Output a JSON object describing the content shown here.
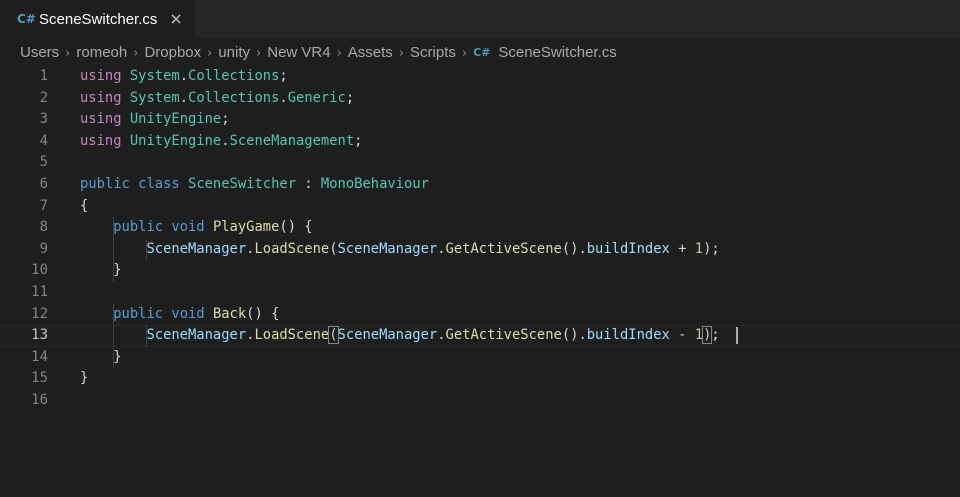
{
  "tab": {
    "icon": "C#",
    "title": "SceneSwitcher.cs",
    "close": "×"
  },
  "breadcrumb": {
    "segments": [
      "Users",
      "romeoh",
      "Dropbox",
      "unity",
      "New VR4",
      "Assets",
      "Scripts"
    ],
    "file_icon": "C#",
    "file": "SceneSwitcher.cs",
    "separator": "›"
  },
  "editor": {
    "current_line": 13,
    "lines": [
      {
        "n": "1",
        "tokens": [
          [
            "kwu",
            "using"
          ],
          [
            "pl",
            " "
          ],
          [
            "ty",
            "System"
          ],
          [
            "pl",
            "."
          ],
          [
            "ty",
            "Collections"
          ],
          [
            "pl",
            ";"
          ]
        ]
      },
      {
        "n": "2",
        "tokens": [
          [
            "kwu",
            "using"
          ],
          [
            "pl",
            " "
          ],
          [
            "ty",
            "System"
          ],
          [
            "pl",
            "."
          ],
          [
            "ty",
            "Collections"
          ],
          [
            "pl",
            "."
          ],
          [
            "ty",
            "Generic"
          ],
          [
            "pl",
            ";"
          ]
        ]
      },
      {
        "n": "3",
        "tokens": [
          [
            "kwu",
            "using"
          ],
          [
            "pl",
            " "
          ],
          [
            "ty",
            "UnityEngine"
          ],
          [
            "pl",
            ";"
          ]
        ]
      },
      {
        "n": "4",
        "tokens": [
          [
            "kwu",
            "using"
          ],
          [
            "pl",
            " "
          ],
          [
            "ty",
            "UnityEngine"
          ],
          [
            "pl",
            "."
          ],
          [
            "ty",
            "SceneManagement"
          ],
          [
            "pl",
            ";"
          ]
        ]
      },
      {
        "n": "5",
        "tokens": []
      },
      {
        "n": "6",
        "tokens": [
          [
            "kw",
            "public"
          ],
          [
            "pl",
            " "
          ],
          [
            "kw",
            "class"
          ],
          [
            "pl",
            " "
          ],
          [
            "ty",
            "SceneSwitcher"
          ],
          [
            "pl",
            " : "
          ],
          [
            "ty",
            "MonoBehaviour"
          ]
        ]
      },
      {
        "n": "7",
        "tokens": [
          [
            "pl",
            "{"
          ]
        ]
      },
      {
        "n": "8",
        "tokens": [
          [
            "pl",
            "    "
          ],
          [
            "kw",
            "public"
          ],
          [
            "pl",
            " "
          ],
          [
            "kw",
            "void"
          ],
          [
            "pl",
            " "
          ],
          [
            "fn",
            "PlayGame"
          ],
          [
            "pl",
            "() {"
          ]
        ]
      },
      {
        "n": "9",
        "tokens": [
          [
            "pl",
            "        "
          ],
          [
            "pr",
            "SceneManager"
          ],
          [
            "pl",
            "."
          ],
          [
            "fn",
            "LoadScene"
          ],
          [
            "pl",
            "("
          ],
          [
            "pr",
            "SceneManager"
          ],
          [
            "pl",
            "."
          ],
          [
            "fn",
            "GetActiveScene"
          ],
          [
            "pl",
            "()."
          ],
          [
            "pr",
            "buildIndex"
          ],
          [
            "pl",
            " + "
          ],
          [
            "num",
            "1"
          ],
          [
            "pl",
            ");"
          ]
        ]
      },
      {
        "n": "10",
        "tokens": [
          [
            "pl",
            "    }"
          ]
        ]
      },
      {
        "n": "11",
        "tokens": []
      },
      {
        "n": "12",
        "tokens": [
          [
            "pl",
            "    "
          ],
          [
            "kw",
            "public"
          ],
          [
            "pl",
            " "
          ],
          [
            "kw",
            "void"
          ],
          [
            "pl",
            " "
          ],
          [
            "fn",
            "Back"
          ],
          [
            "pl",
            "() {"
          ]
        ]
      },
      {
        "n": "13",
        "tokens": [
          [
            "pl",
            "        "
          ],
          [
            "pr",
            "SceneManager"
          ],
          [
            "pl",
            "."
          ],
          [
            "fn",
            "LoadScene"
          ],
          [
            "bm",
            "("
          ],
          [
            "pr",
            "SceneManager"
          ],
          [
            "pl",
            "."
          ],
          [
            "fn",
            "GetActiveScene"
          ],
          [
            "pl",
            "()."
          ],
          [
            "pr",
            "buildIndex"
          ],
          [
            "pl",
            " - "
          ],
          [
            "num",
            "1"
          ],
          [
            "bm",
            ")"
          ],
          [
            "pl",
            ";"
          ]
        ]
      },
      {
        "n": "14",
        "tokens": [
          [
            "pl",
            "    }"
          ]
        ]
      },
      {
        "n": "15",
        "tokens": [
          [
            "pl",
            "}"
          ]
        ]
      },
      {
        "n": "16",
        "tokens": []
      }
    ]
  }
}
